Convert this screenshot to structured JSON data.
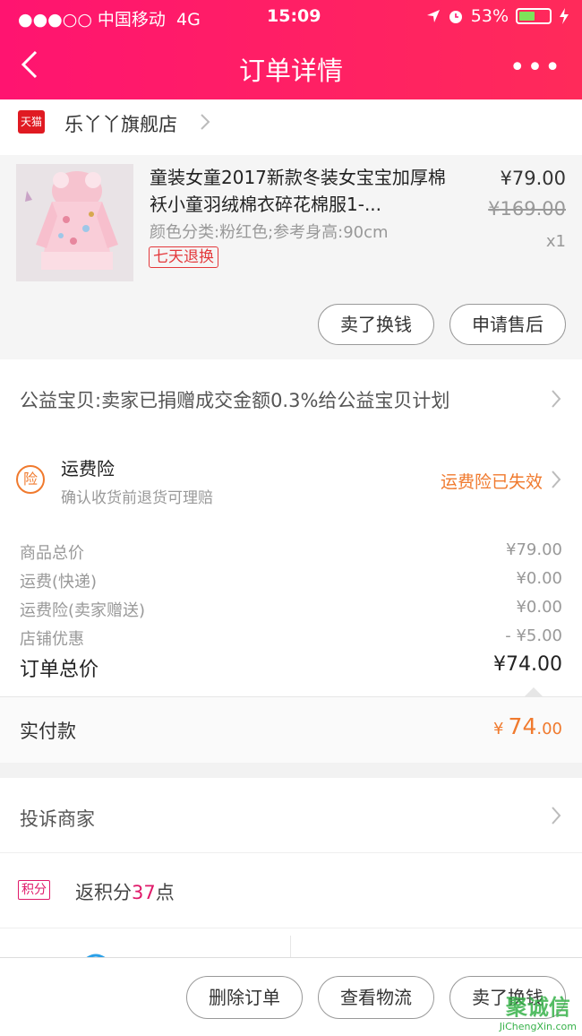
{
  "status_bar": {
    "carrier": "●●●○○ 中国移动",
    "network": "4G",
    "time": "15:09",
    "battery": "53%",
    "battery_level": 0.53
  },
  "nav": {
    "title": "订单详情",
    "more": "•••"
  },
  "shop": {
    "name": "乐丫丫旗舰店",
    "badge": "天猫"
  },
  "product": {
    "title": "童装女童2017新款冬装女宝宝加厚棉袄小童羽绒棉衣碎花棉服1-...",
    "spec": "颜色分类:粉红色;参考身高:90cm",
    "tag": "七天退换",
    "price": "¥79.00",
    "original_price": "¥169.00",
    "qty": "x1",
    "buttons": [
      "卖了换钱",
      "申请售后"
    ]
  },
  "charity": {
    "text": "公益宝贝:卖家已捐赠成交金额0.3%给公益宝贝计划"
  },
  "insurance": {
    "badge": "险",
    "title": "运费险",
    "desc": "确认收货前退货可理赔",
    "status": "运费险已失效"
  },
  "summary": {
    "rows": [
      {
        "label": "商品总价",
        "value": "¥79.00"
      },
      {
        "label": "运费(快递)",
        "value": "¥0.00"
      },
      {
        "label": "运费险(卖家赠送)",
        "value": "¥0.00"
      },
      {
        "label": "店铺优惠",
        "value": "- ¥5.00"
      }
    ],
    "total_label": "订单总价",
    "total_value": "¥74.00"
  },
  "paid": {
    "label": "实付款",
    "currency": "¥",
    "int": "74",
    "dec": ".00"
  },
  "complain": {
    "text": "投诉商家"
  },
  "points": {
    "badge": "积分",
    "prefix": "返积分",
    "num": "37",
    "suffix": "点"
  },
  "bottom": {
    "buttons": [
      "删除订单",
      "查看物流",
      "卖了换钱"
    ]
  },
  "watermark": {
    "main": "聚诚信",
    "sub": "JiChengXin.com"
  },
  "colors": {
    "brand": "#ff1470",
    "accent": "#f07a2e",
    "points": "#e01a6a"
  }
}
